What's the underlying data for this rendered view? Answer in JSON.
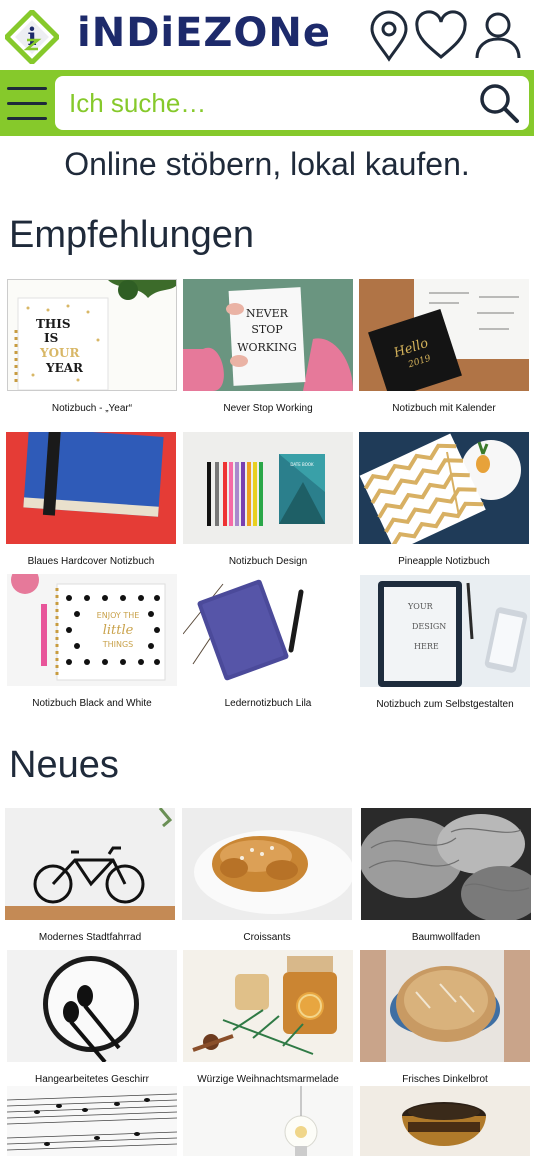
{
  "header": {
    "logo_text": "iNDiEZONe",
    "icons": [
      "location-pin-icon",
      "heart-icon",
      "user-icon"
    ]
  },
  "search": {
    "placeholder": "Ich suche…"
  },
  "tagline": "Online stöbern, lokal kaufen.",
  "recommendations": {
    "title": "Empfehlungen",
    "items": [
      {
        "label": "Notizbuch - „Year“"
      },
      {
        "label": "Never Stop Working"
      },
      {
        "label": "Notizbuch mit Kalender"
      },
      {
        "label": "Blaues Hardcover Notizbuch"
      },
      {
        "label": "Notizbuch Design"
      },
      {
        "label": "Pineapple Notizbuch"
      },
      {
        "label": "Notizbuch Black and White"
      },
      {
        "label": "Ledernotizbuch Lila"
      },
      {
        "label": "Notizbuch zum Selbstgestalten"
      }
    ]
  },
  "new": {
    "title": "Neues",
    "items": [
      {
        "label": "Modernes Stadtfahrrad"
      },
      {
        "label": "Croissants"
      },
      {
        "label": "Baumwollfaden"
      },
      {
        "label": "Hangearbeitetes Geschirr"
      },
      {
        "label": "Würzige Weihnachtsmarmelade"
      },
      {
        "label": "Frisches Dinkelbrot"
      }
    ]
  },
  "artwork": {
    "year_cover": "THIS IS YOUR YEAR",
    "nsw_cover": "NEVER STOP WORKING",
    "hello_cover": "Hello 2019",
    "enjoy_cover": "ENJOY THE little THINGS",
    "design_cover": "YOUR DESIGN HERE"
  },
  "colors": {
    "brand_green": "#86c92b",
    "brand_navy": "#1d2a6b",
    "text_dark": "#1f2a3a"
  }
}
